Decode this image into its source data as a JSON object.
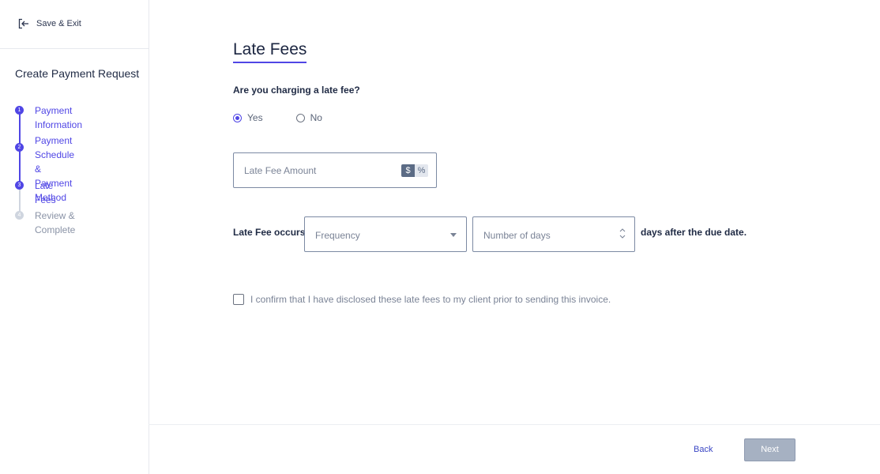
{
  "sidebar": {
    "exit_label": "Save & Exit",
    "title": "Create Payment Request",
    "steps": [
      {
        "num": "1",
        "label": "Payment Information",
        "state": "done"
      },
      {
        "num": "2",
        "label": "Payment Schedule & Payment Method",
        "line1": "Payment Schedule &",
        "line2": "Payment Method",
        "state": "done"
      },
      {
        "num": "3",
        "label": "Late Fees",
        "state": "current"
      },
      {
        "num": "4",
        "label": "Review & Complete",
        "state": "upcoming"
      }
    ]
  },
  "main": {
    "title": "Late Fees",
    "question": "Are you charging a late fee?",
    "radio_options": [
      {
        "label": "Yes",
        "selected": true
      },
      {
        "label": "No",
        "selected": false
      }
    ],
    "late_fee_amount": {
      "placeholder": "Late Fee Amount",
      "value": "",
      "unit_options": [
        "$",
        "%"
      ],
      "selected_unit": "$"
    },
    "occurs_label": "Late Fee occurs",
    "frequency": {
      "placeholder": "Frequency",
      "value": ""
    },
    "days": {
      "placeholder": "Number of days",
      "value": ""
    },
    "after_label": "days after the due date.",
    "confirm_label": "I confirm that I have disclosed these late fees to my client prior to sending this invoice.",
    "confirm_checked": false
  },
  "footer": {
    "back_label": "Back",
    "next_label": "Next"
  },
  "colors": {
    "accent": "#5046e5",
    "text": "#1f2a44",
    "muted": "#7a8396",
    "disabled_button": "#a6b1c2"
  }
}
